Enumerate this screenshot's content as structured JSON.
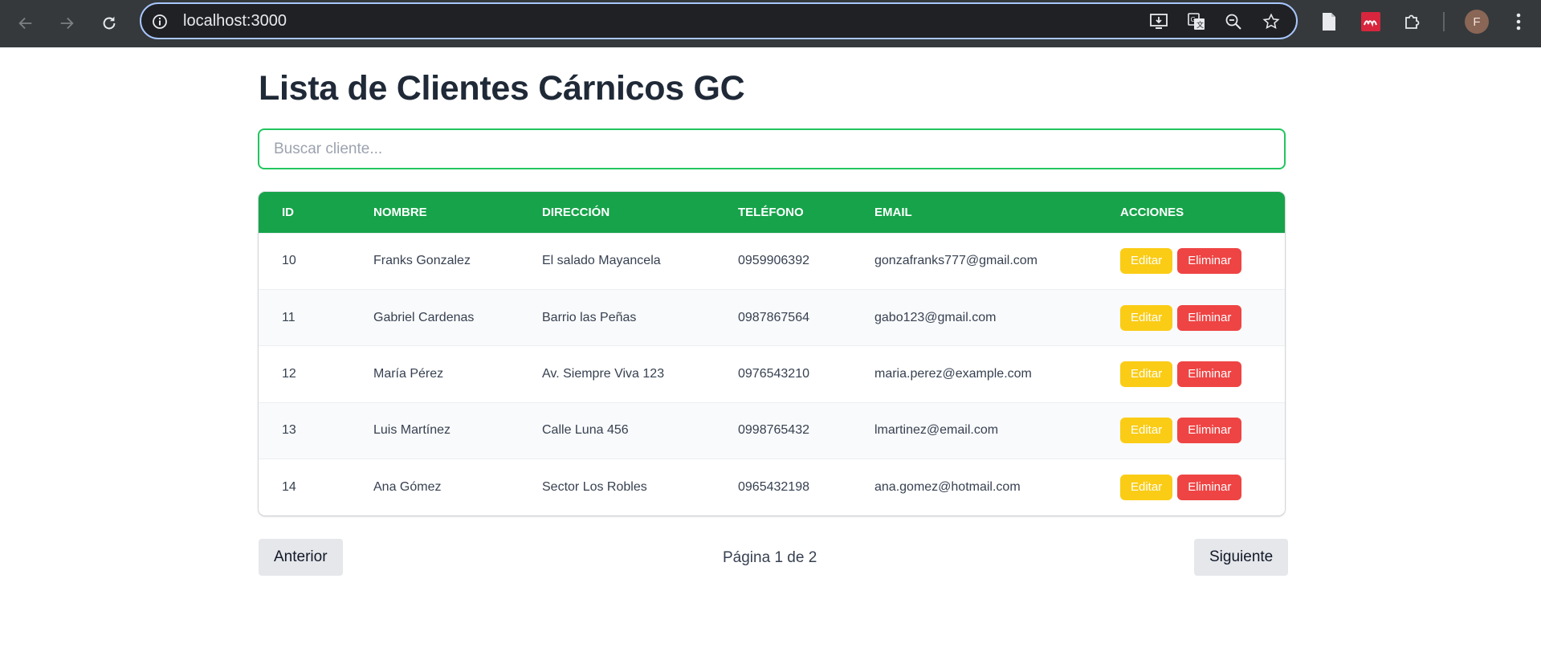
{
  "browser": {
    "url": "localhost:3000",
    "profile_initial": "F",
    "icons": [
      "back-icon",
      "forward-icon",
      "reload-icon",
      "site-info-icon",
      "install-app-icon",
      "translate-icon",
      "zoom-icon",
      "bookmark-star-icon",
      "reading-list-icon",
      "mendeley-extension-icon",
      "extensions-puzzle-icon",
      "menu-kebab-icon"
    ]
  },
  "page": {
    "title": "Lista de Clientes Cárnicos GC",
    "search_placeholder": "Buscar cliente..."
  },
  "table": {
    "headers": [
      "ID",
      "NOMBRE",
      "DIRECCIÓN",
      "TELÉFONO",
      "EMAIL",
      "ACCIONES"
    ],
    "rows": [
      {
        "id": "10",
        "nombre": "Franks Gonzalez",
        "direccion": "El salado Mayancela",
        "telefono": "0959906392",
        "email": "gonzafranks777@gmail.com"
      },
      {
        "id": "11",
        "nombre": "Gabriel Cardenas",
        "direccion": "Barrio las Peñas",
        "telefono": "0987867564",
        "email": "gabo123@gmail.com"
      },
      {
        "id": "12",
        "nombre": "María Pérez",
        "direccion": "Av. Siempre Viva 123",
        "telefono": "0976543210",
        "email": "maria.perez@example.com"
      },
      {
        "id": "13",
        "nombre": "Luis Martínez",
        "direccion": "Calle Luna 456",
        "telefono": "0998765432",
        "email": "lmartinez@email.com"
      },
      {
        "id": "14",
        "nombre": "Ana Gómez",
        "direccion": "Sector Los Robles",
        "telefono": "0965432198",
        "email": "ana.gomez@hotmail.com"
      }
    ],
    "edit_label": "Editar",
    "delete_label": "Eliminar"
  },
  "pagination": {
    "prev_label": "Anterior",
    "next_label": "Siguiente",
    "info": "Página 1 de 2"
  },
  "colors": {
    "header_green": "#16a34a",
    "search_border": "#22c55e",
    "edit_yellow": "#facc15",
    "delete_red": "#ef4444"
  }
}
